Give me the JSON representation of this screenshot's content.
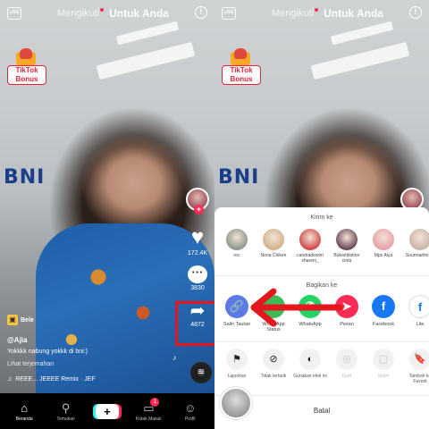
{
  "top_bar": {
    "live_label": "LIVE",
    "following_tab": "Mengikuti",
    "for_you_tab": "Untuk Anda",
    "alert_glyph": "!"
  },
  "bonus": {
    "label": "TikTok Bonus"
  },
  "rail": {
    "likes": "172.4K",
    "comments": "3830",
    "shares": "4872"
  },
  "post": {
    "product_chip": "Bele",
    "author": "@Ajia",
    "description": "Yokkkk nabung yokkk di bni:)",
    "translation_link": "Lihat terjemahan",
    "sound": "REEE... JEEEE Remix · JEF"
  },
  "nav": {
    "home": "Beranda",
    "discover": "Temukan",
    "inbox": "Kotak Masuk",
    "inbox_badge": "1",
    "profile": "Profil"
  },
  "share_sheet": {
    "send_to_title": "Kirim ke",
    "share_to_title": "Bagikan ke",
    "contacts": [
      {
        "name": "roc",
        "color": "#8c9a8b"
      },
      {
        "name": "Nona Chiken",
        "color": "#d3b38a"
      },
      {
        "name": "candradewim shareni_",
        "color": "#d24a4a"
      },
      {
        "name": "Bukanbloktor cinta",
        "color": "#6b4a5a"
      },
      {
        "name": "Mpo Alya",
        "color": "#e7a3a6"
      },
      {
        "name": "Sourmartini.ex",
        "color": "#c9b6a8"
      }
    ],
    "apps": [
      {
        "label": "Salin Tautan",
        "glyph": "🔗",
        "color": "#5b7ae6"
      },
      {
        "label": "WhatsApp Status",
        "glyph": "◔",
        "color": "#3dbb57"
      },
      {
        "label": "WhatsApp",
        "glyph": "✆",
        "color": "#25d366"
      },
      {
        "label": "Pesan",
        "glyph": "➤",
        "color": "#fe2c55"
      },
      {
        "label": "Facebook",
        "glyph": "f",
        "color": "#1877f2"
      },
      {
        "label": "Lite",
        "glyph": "f",
        "color": "#ffffff"
      }
    ],
    "actions": [
      {
        "label": "Laporkan",
        "glyph": "⚑",
        "disabled": false
      },
      {
        "label": "Tidak tertarik",
        "glyph": "⊘",
        "disabled": false
      },
      {
        "label": "Gunakan efek ini",
        "glyph": "◐",
        "disabled": false
      },
      {
        "label": "Duet",
        "glyph": "◎",
        "disabled": true
      },
      {
        "label": "Stitch",
        "glyph": "▢",
        "disabled": true
      },
      {
        "label": "Tambah ke Favorit",
        "glyph": "🔖",
        "disabled": false
      }
    ],
    "cancel_label": "Batal"
  },
  "colors": {
    "accent_red": "#fe2c55",
    "annotation_red": "#e5161d"
  }
}
